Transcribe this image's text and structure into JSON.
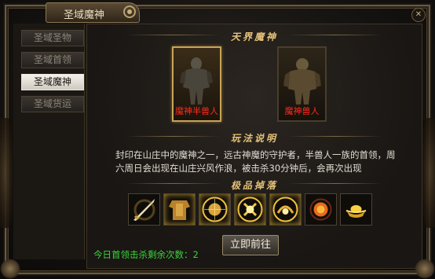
{
  "window": {
    "title": "圣域魔神"
  },
  "sidebar": {
    "items": [
      {
        "label": "圣域圣物",
        "active": false
      },
      {
        "label": "圣域首领",
        "active": false
      },
      {
        "label": "圣域魔神",
        "active": true
      },
      {
        "label": "圣域货运",
        "active": false
      }
    ]
  },
  "sections": {
    "boss_header": "天界魔神",
    "rules_header": "玩法说明",
    "drops_header": "极品掉落"
  },
  "bosses": [
    {
      "name": "魔神半兽人",
      "selected": true,
      "icon": "beastman-figure-icon"
    },
    {
      "name": "魔神兽人",
      "selected": false,
      "icon": "orc-figure-icon"
    }
  ],
  "description": "封印在山庄中的魔神之一，远古神魔的守护者，半兽人一族的首领，周六周日会出现在山庄兴风作浪，被击杀30分钟后，会再次出现",
  "drops": [
    {
      "icon": "sword-item-icon"
    },
    {
      "icon": "armor-item-icon"
    },
    {
      "icon": "golden-orb-item-icon"
    },
    {
      "icon": "golden-orb-item-icon"
    },
    {
      "icon": "golden-orb-item-icon"
    },
    {
      "icon": "fire-gem-item-icon"
    },
    {
      "icon": "gold-ingot-item-icon"
    }
  ],
  "go_button": "立即前往",
  "remaining_kills": "今日首领击杀剩余次数：2",
  "colors": {
    "accent_gold": "#e6c27a",
    "boss_name_red": "#ff2a1a",
    "remaining_green": "#3ad43a"
  }
}
